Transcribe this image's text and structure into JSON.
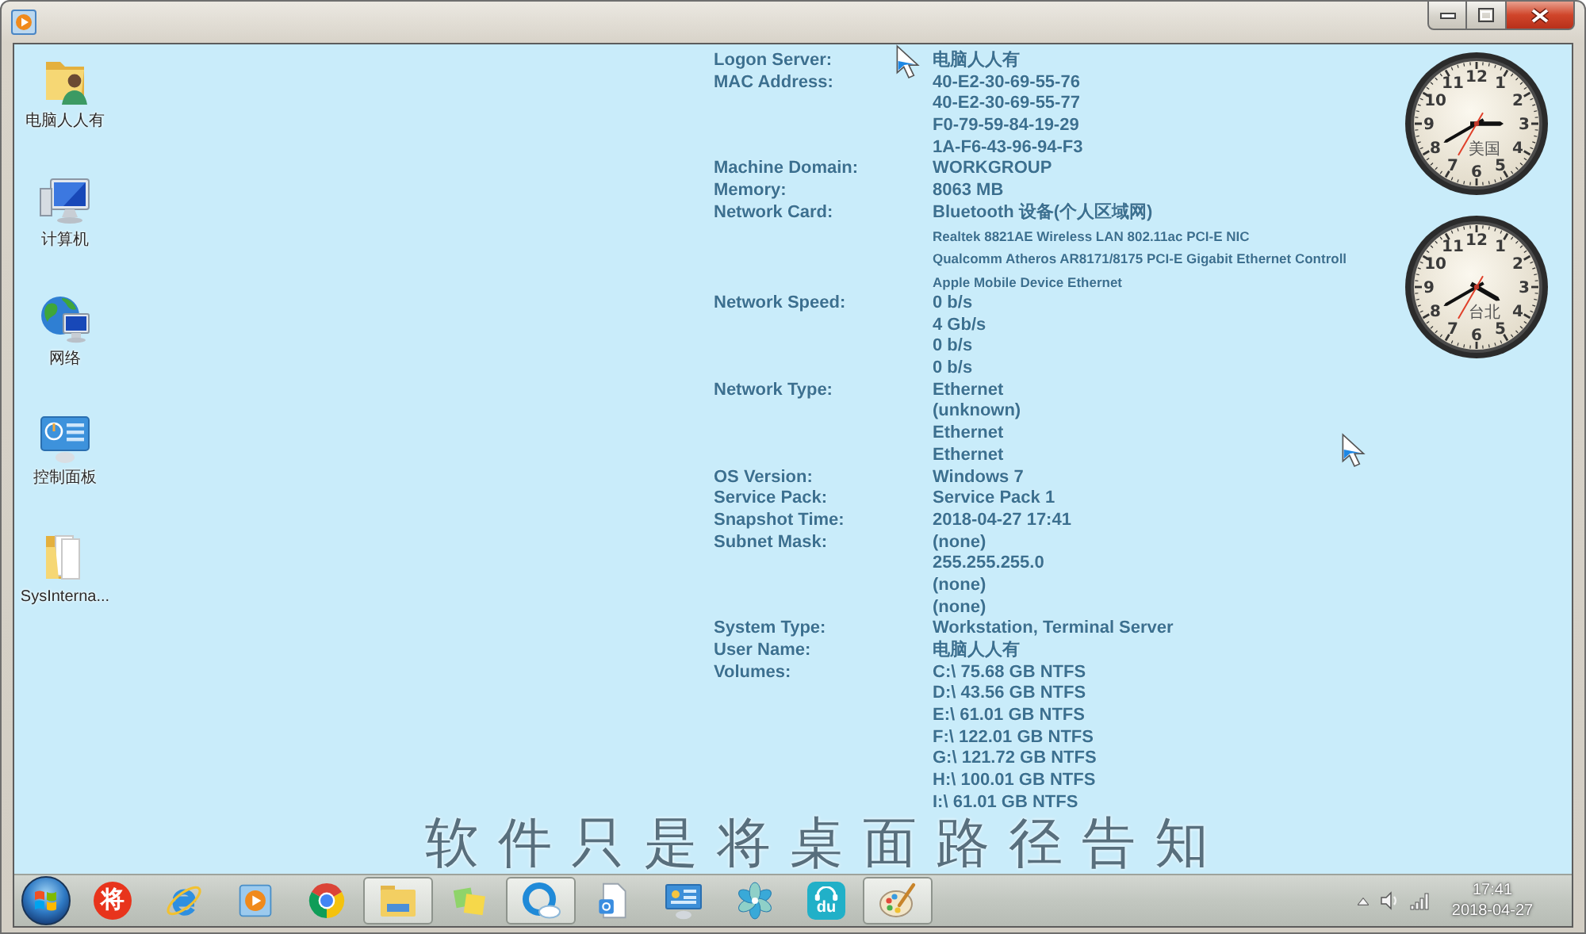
{
  "desktop_icons": [
    {
      "kind": "user-folder",
      "label": "电脑人人有"
    },
    {
      "kind": "computer",
      "label": "计算机"
    },
    {
      "kind": "network",
      "label": "网络"
    },
    {
      "kind": "control-panel",
      "label": "控制面板"
    },
    {
      "kind": "folder",
      "label": "SysInterna..."
    }
  ],
  "system_info": [
    {
      "label": "Logon Server:",
      "values": [
        "电脑人人有"
      ]
    },
    {
      "label": "MAC Address:",
      "values": [
        "40-E2-30-69-55-76",
        "40-E2-30-69-55-77",
        "F0-79-59-84-19-29",
        "1A-F6-43-96-94-F3"
      ]
    },
    {
      "label": "Machine Domain:",
      "values": [
        "WORKGROUP"
      ]
    },
    {
      "label": "Memory:",
      "values": [
        "8063 MB"
      ]
    },
    {
      "label": "Network Card:",
      "values": [
        "Bluetooth 设备(个人区域网)"
      ],
      "adapters": [
        "Realtek 8821AE Wireless LAN 802.11ac PCI-E NIC",
        "Qualcomm Atheros AR8171/8175 PCI-E Gigabit Ethernet Controll",
        "Apple Mobile Device Ethernet"
      ]
    },
    {
      "label": "Network Speed:",
      "values": [
        "0 b/s",
        "4 Gb/s",
        "0 b/s",
        "0 b/s"
      ]
    },
    {
      "label": "Network Type:",
      "values": [
        "Ethernet",
        "(unknown)",
        "Ethernet",
        "Ethernet"
      ]
    },
    {
      "label": "OS Version:",
      "values": [
        "Windows 7"
      ]
    },
    {
      "label": "Service Pack:",
      "values": [
        "Service Pack 1"
      ]
    },
    {
      "label": "Snapshot Time:",
      "values": [
        "2018-04-27 17:41"
      ]
    },
    {
      "label": "Subnet Mask:",
      "values": [
        "(none)",
        "255.255.255.0",
        "(none)",
        "(none)"
      ]
    },
    {
      "label": "System Type:",
      "values": [
        "Workstation, Terminal Server"
      ]
    },
    {
      "label": "User Name:",
      "values": [
        "电脑人人有"
      ]
    },
    {
      "label": "Volumes:",
      "values": [
        "C:\\ 75.68 GB NTFS",
        "D:\\ 43.56 GB NTFS",
        "E:\\ 61.01 GB NTFS",
        "F:\\ 122.01 GB NTFS",
        "G:\\ 121.72 GB NTFS",
        "H:\\ 100.01 GB NTFS",
        "I:\\ 61.01 GB NTFS"
      ]
    }
  ],
  "clocks": [
    {
      "numerals": [
        {
          "text": "11",
          "hour_hand": false,
          "minute_hand": false,
          "second_hand": false
        },
        {
          "text": "12",
          "hour_hand": false,
          "minute_hand": false,
          "second_hand": false
        },
        {
          "text": "1",
          "hour_hand": false,
          "minute_hand": false,
          "second_hand": false
        },
        {
          "text": "10",
          "hour_hand": false,
          "minute_hand": false,
          "second_hand": false
        },
        {
          "text": "2",
          "hour_hand": false,
          "minute_hand": false,
          "second_hand": false
        },
        {
          "text": "9",
          "hour_hand": false,
          "minute_hand": false,
          "second_hand": false
        },
        {
          "text": "3",
          "hour_hand": true,
          "minute_hand": false,
          "second_hand": false
        },
        {
          "text": "8",
          "hour_hand": false,
          "minute_hand": true,
          "second_hand": false
        }
      ],
      "city": "美国",
      "lower_numerals": [
        {
          "text": "4",
          "hour_hand": false,
          "minute_hand": false,
          "second_hand": false
        },
        {
          "text": "7",
          "hour_hand": false,
          "minute_hand": false,
          "second_hand": true
        },
        {
          "text": "6",
          "hour_hand": false,
          "minute_hand": false,
          "second_hand": false
        },
        {
          "text": "5",
          "hour_hand": false,
          "minute_hand": false,
          "second_hand": false
        }
      ]
    },
    {
      "numerals": [
        {
          "text": "11",
          "hour_hand": false,
          "minute_hand": false,
          "second_hand": false
        },
        {
          "text": "12",
          "hour_hand": false,
          "minute_hand": false,
          "second_hand": false
        },
        {
          "text": "1",
          "hour_hand": false,
          "minute_hand": false,
          "second_hand": false
        },
        {
          "text": "10",
          "hour_hand": false,
          "minute_hand": false,
          "second_hand": false
        },
        {
          "text": "2",
          "hour_hand": false,
          "minute_hand": false,
          "second_hand": false
        },
        {
          "text": "9",
          "hour_hand": false,
          "minute_hand": false,
          "second_hand": false
        },
        {
          "text": "3",
          "hour_hand": false,
          "minute_hand": false,
          "second_hand": false
        },
        {
          "text": "8",
          "hour_hand": false,
          "minute_hand": true,
          "second_hand": false
        }
      ],
      "city": "台北",
      "lower_numerals": [
        {
          "text": "4",
          "hour_hand": true,
          "minute_hand": false,
          "second_hand": false
        },
        {
          "text": "7",
          "hour_hand": false,
          "minute_hand": false,
          "second_hand": true
        },
        {
          "text": "6",
          "hour_hand": false,
          "minute_hand": false,
          "second_hand": false
        },
        {
          "text": "5",
          "hour_hand": false,
          "minute_hand": false,
          "second_hand": false
        }
      ]
    }
  ],
  "subtitle": "软件只是将桌面路径告知",
  "taskbar": {
    "items": [
      {
        "kind": "text-disc",
        "label": "将",
        "running": false
      },
      {
        "kind": "e-logo",
        "running": false
      },
      {
        "kind": "play-tile",
        "running": false
      },
      {
        "kind": "color-wheel",
        "running": false
      },
      {
        "kind": "folder",
        "running": true
      },
      {
        "kind": "notes",
        "running": false
      },
      {
        "kind": "ring-cloud",
        "running": true
      },
      {
        "kind": "document",
        "running": false
      },
      {
        "kind": "monitor-panel",
        "running": false
      },
      {
        "kind": "pinwheel",
        "running": false
      },
      {
        "kind": "text-tile",
        "label": "du",
        "running": false
      },
      {
        "kind": "palette",
        "running": true
      }
    ],
    "tray": {
      "time": "17:41",
      "date": "2018-04-27"
    }
  }
}
